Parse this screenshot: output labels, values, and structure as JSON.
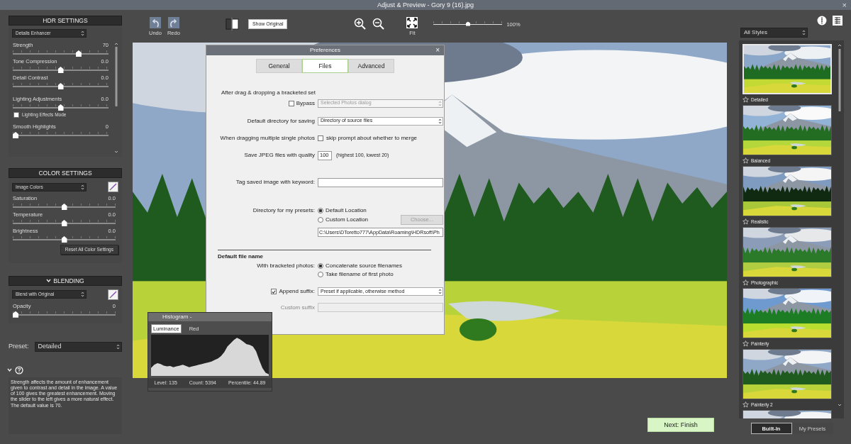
{
  "window": {
    "title": "Adjust & Preview - Gory 9 (16).jpg",
    "close": "×"
  },
  "hdr_settings": {
    "title": "HDR SETTINGS",
    "method": "Details Enhancer",
    "items": [
      {
        "kind": "slider",
        "label": "Strength",
        "value": "70",
        "level": 0.7
      },
      {
        "kind": "slider",
        "label": "Tone Compression",
        "value": "0.0",
        "level": 0.5
      },
      {
        "kind": "slider",
        "label": "Detail Contrast",
        "value": "0.0",
        "level": 0.5
      },
      {
        "kind": "slider",
        "label": "Lighting Adjustments",
        "value": "0.0",
        "level": 0.5
      },
      {
        "kind": "checkbox",
        "label": "Lighting Effects Mode",
        "checked": false
      },
      {
        "kind": "slider",
        "label": "Smooth Highlights",
        "value": "0",
        "level": 0
      }
    ]
  },
  "color_settings": {
    "title": "COLOR SETTINGS",
    "mode": "Image Colors",
    "sliders": [
      {
        "label": "Saturation",
        "value": "0.0",
        "level": 0.5
      },
      {
        "label": "Temperature",
        "value": "0.0",
        "level": 0.5
      },
      {
        "label": "Brightness",
        "value": "0.0",
        "level": 0.5
      }
    ],
    "reset_button": "Reset All Color Settings"
  },
  "blending": {
    "title": "BLENDING",
    "expanded": true,
    "mode": "Blend with Original",
    "sliders": [
      {
        "label": "Opacity",
        "value": "0",
        "level": 0
      }
    ]
  },
  "preset": {
    "label": "Preset:",
    "value": "Detailed"
  },
  "help": {
    "expanded": true,
    "text": "Strength affects the amount of enhancement given to contrast and detail in the image. A value of 100 gives the greatest enhancement. Moving the slider to the left gives a more natural effect. The default value is 70."
  },
  "toolbar": {
    "history": [
      {
        "label": "Undo"
      },
      {
        "label": "Redo"
      }
    ],
    "show_original": "Show Original",
    "fit": "Fit",
    "zoom": {
      "level": 0.5,
      "reading": "100%"
    }
  },
  "preferences": {
    "title": "Preferences",
    "close": "×",
    "tabs": [
      {
        "label": "General",
        "selected": false
      },
      {
        "label": "Files",
        "selected": true
      },
      {
        "label": "Advanced",
        "selected": false
      }
    ],
    "after_drag_heading": "After drag & dropping a bracketed set",
    "bypass": {
      "label": "Bypass",
      "checked": false,
      "dropdown": "Selected Photos dialog",
      "disabled": true
    },
    "default_directory": {
      "label": "Default directory for saving",
      "dropdown": "Directory of source files"
    },
    "multiple_photos": {
      "label": "When dragging multiple single photos",
      "checkbox_label": "skip prompt about whether to merge",
      "checked": false
    },
    "jpeg_quality": {
      "label": "Save JPEG files with quality",
      "value": "100",
      "hint": "(highest 100, lowest 20)"
    },
    "keyword": {
      "label": "Tag saved image with keyword:"
    },
    "presets_directory": {
      "label": "Directory for my presets:",
      "options": [
        {
          "label": "Default Location",
          "selected": true
        },
        {
          "label": "Custom Location",
          "selected": false
        }
      ],
      "choose_button": {
        "label": "Choose...",
        "disabled": true
      },
      "path": "C:\\Users\\DToretto777\\AppData\\Roaming\\HDRsoft\\Ph"
    },
    "file_name_heading": "Default file name",
    "bracketed": {
      "label": "With bracketed photos:",
      "options": [
        {
          "label": "Concatenate source filenames",
          "selected": true
        },
        {
          "label": "Take filename of first photo",
          "selected": false
        }
      ]
    },
    "append_suffix": {
      "label": "Append suffix:",
      "checked": true,
      "dropdown": "Preset if applicable, otherwise method"
    },
    "custom_suffix": {
      "label": "Custom suffix",
      "disabled": true
    }
  },
  "histogram": {
    "title": "Histogram -",
    "tabs": [
      {
        "label": "Luminance",
        "selected": true
      },
      {
        "label": "Red",
        "selected": false
      }
    ],
    "stats": [
      "Level: 135",
      "Count: 5394",
      "Percentile: 44.89"
    ]
  },
  "styles": {
    "filter": "All Styles",
    "items": [
      {
        "name": "Detailed",
        "selected": true,
        "favorite": false
      },
      {
        "name": "Balanced",
        "selected": false,
        "favorite": false
      },
      {
        "name": "Realistic",
        "selected": false,
        "favorite": false
      },
      {
        "name": "Photographic",
        "selected": false,
        "favorite": false
      },
      {
        "name": "Painterly",
        "selected": false,
        "favorite": false
      },
      {
        "name": "Painterly 2",
        "selected": false,
        "favorite": false
      }
    ],
    "tabs": [
      {
        "label": "Built-In",
        "selected": true
      },
      {
        "label": "My Presets",
        "selected": false
      }
    ]
  },
  "next_button": "Next: Finish"
}
